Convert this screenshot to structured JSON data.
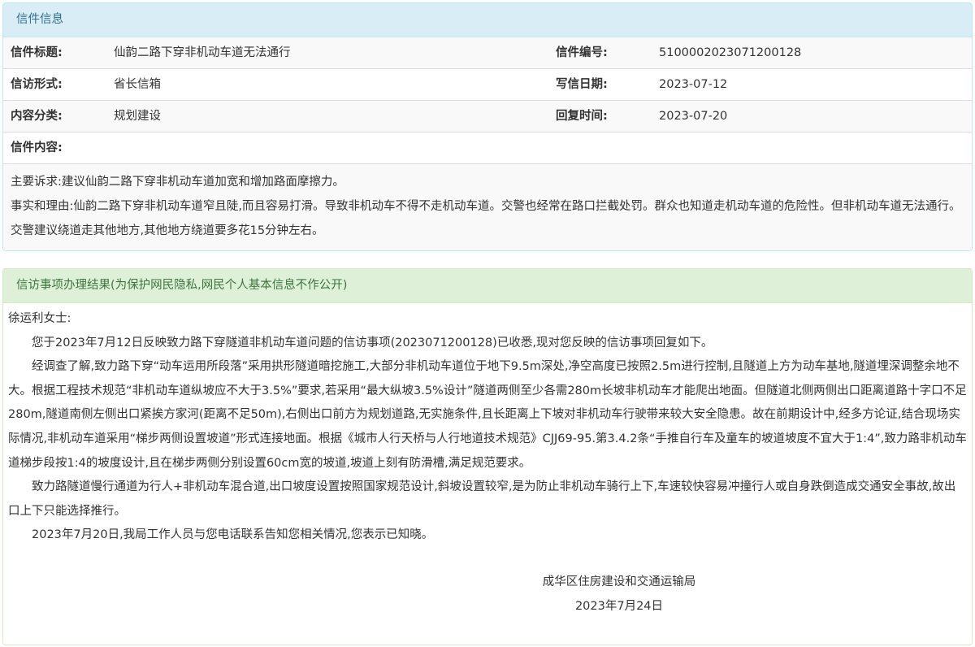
{
  "info": {
    "header": "信件信息",
    "rows": [
      {
        "label1": "信件标题:",
        "value1": "仙韵二路下穿非机动车道无法通行",
        "label2": "信件编号:",
        "value2": "5100002023071200128"
      },
      {
        "label1": "信访形式:",
        "value1": "省长信箱",
        "label2": "写信日期:",
        "value2": "2023-07-12"
      },
      {
        "label1": "内容分类:",
        "value1": "规划建设",
        "label2": "回复时间:",
        "value2": "2023-07-20"
      }
    ],
    "content_label": "信件内容:",
    "content": [
      "主要诉求:建议仙韵二路下穿非机动车道加宽和增加路面摩擦力。",
      "事实和理由:仙韵二路下穿非机动车道窄且陡,而且容易打滑。导致非机动车不得不走机动车道。交警也经常在路口拦截处罚。群众也知道走机动车道的危险性。但非机动车道无法通行。交警建议绕道走其他地方,其他地方绕道要多花15分钟左右。"
    ]
  },
  "result": {
    "header": "信访事项办理结果(为保护网民隐私,网民个人基本信息不作公开)",
    "salutation": "徐运利女士:",
    "paragraphs": [
      "您于2023年7月12日反映致力路下穿隧道非机动车道问题的信访事项(2023071200128)已收悉,现对您反映的信访事项回复如下。",
      "经调查了解,致力路下穿“动车运用所段落”采用拱形隧道暗挖施工,大部分非机动车道位于地下9.5m深处,净空高度已按照2.5m进行控制,且隧道上方为动车基地,隧道埋深调整余地不大。根据工程技术规范“非机动车道纵坡应不大于3.5%”要求,若采用“最大纵坡3.5%设计”隧道两侧至少各需280m长坡非机动车才能爬出地面。但隧道北侧两侧出口距离道路十字口不足280m,隧道南侧左侧出口紧挨方家河(距离不足50m),右侧出口前方为规划道路,无实施条件,且长距离上下坡对非机动车行驶带来较大安全隐患。故在前期设计中,经多方论证,结合现场实际情况,非机动车道采用“梯步两侧设置坡道”形式连接地面。根据《城市人行天桥与人行地道技术规范》CJJ69-95.第3.4.2条“手推自行车及童车的坡道坡度不宜大于1:4”,致力路非机动车道梯步段按1:4的坡度设计,且在梯步两侧分别设置60cm宽的坡道,坡道上刻有防滑槽,满足规范要求。",
      "致力路隧道慢行通道为行人+非机动车混合道,出口坡度设置按照国家规范设计,斜坡设置较窄,是为防止非机动车骑行上下,车速较快容易冲撞行人或自身跌倒造成交通安全事故,故出口上下只能选择推行。",
      "2023年7月20日,我局工作人员与您电话联系告知您相关情况,您表示已知晓。"
    ],
    "signature": "成华区住房建设和交通运输局",
    "date": "2023年7月24日"
  }
}
